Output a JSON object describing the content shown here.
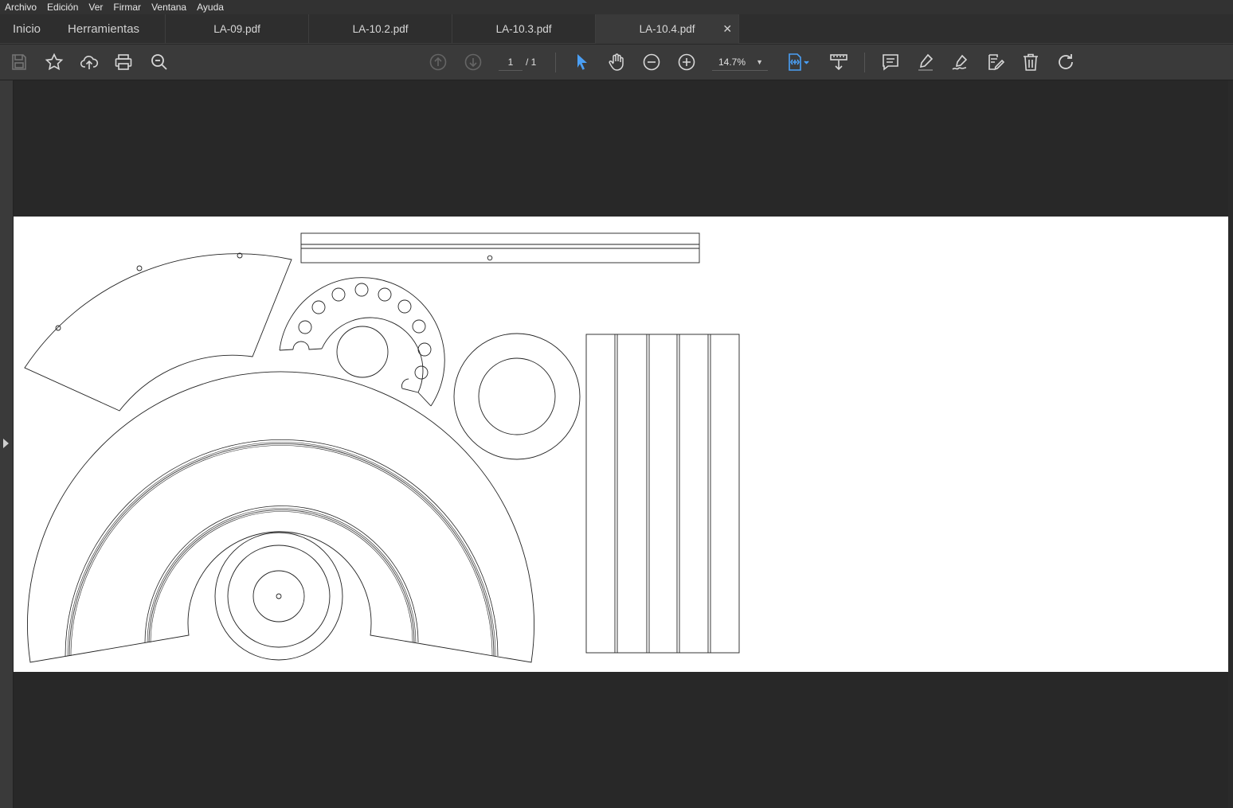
{
  "menu": {
    "items": [
      "Archivo",
      "Edición",
      "Ver",
      "Firmar",
      "Ventana",
      "Ayuda"
    ]
  },
  "tabs": {
    "home": "Inicio",
    "tools": "Herramientas",
    "documents": [
      "LA-09.pdf",
      "LA-10.2.pdf",
      "LA-10.3.pdf",
      "LA-10.4.pdf"
    ],
    "active_index": 3,
    "close_glyph": "✕"
  },
  "toolbar": {
    "current_page": "1",
    "page_count": "/ 1",
    "zoom": "14.7%",
    "accent_color": "#4a9ff5",
    "icons": [
      "save-icon",
      "star-icon",
      "cloud-upload-icon",
      "print-icon",
      "zoom-search-icon",
      "page-up-icon",
      "page-down-icon",
      "select-cursor-icon",
      "hand-icon",
      "zoom-out-icon",
      "zoom-in-icon",
      "fit-page-icon",
      "scroll-mode-icon",
      "comment-icon",
      "highlight-icon",
      "sign-icon",
      "edit-text-icon",
      "trash-icon",
      "rotate-icon"
    ]
  }
}
